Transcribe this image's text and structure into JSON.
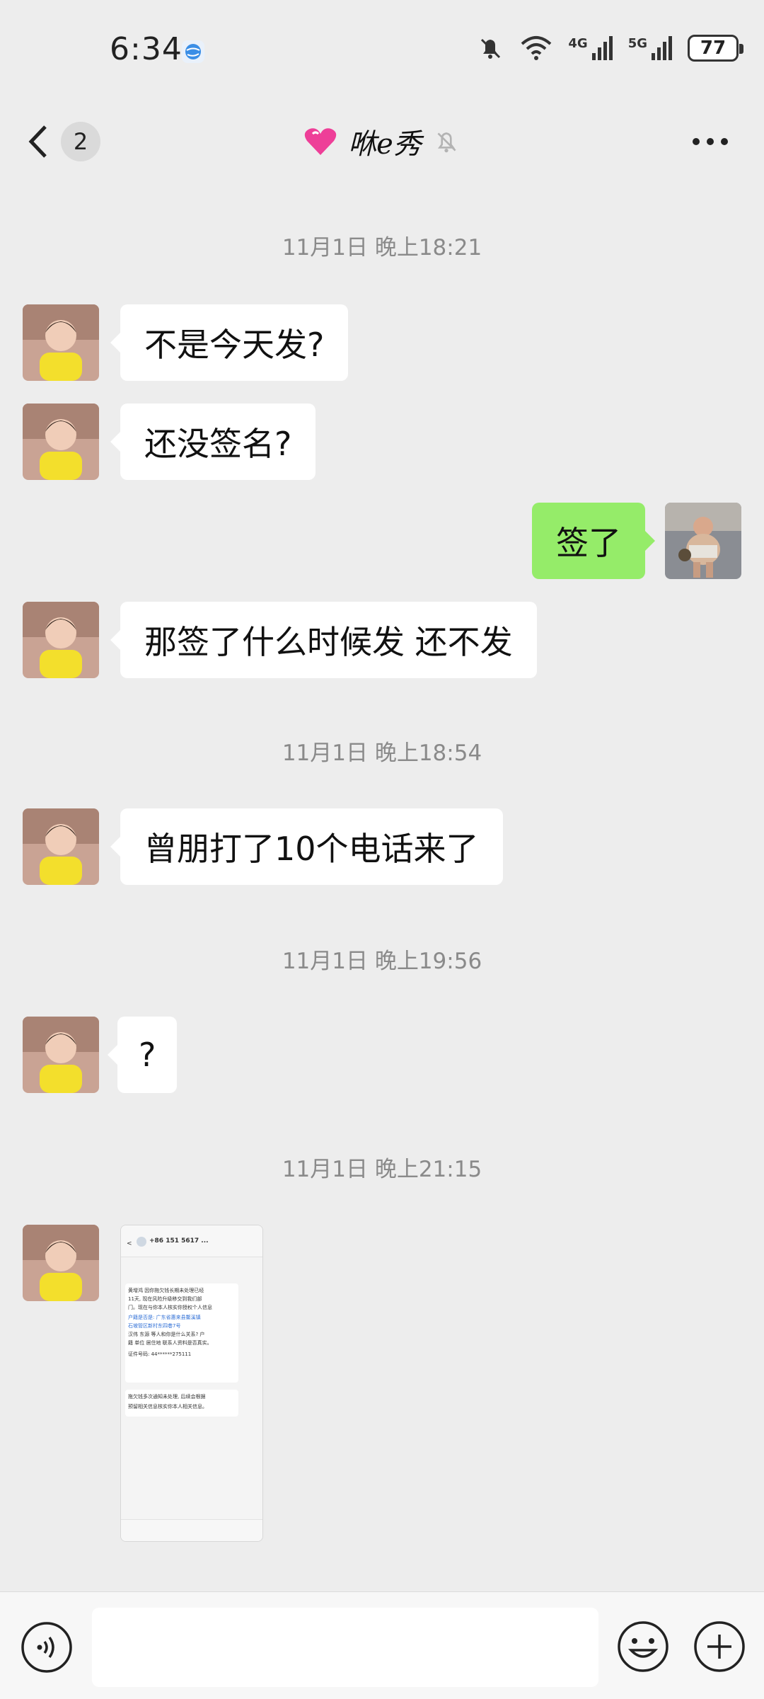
{
  "status_bar": {
    "time": "6:34",
    "network1": "4G",
    "network2": "5G",
    "battery": "77"
  },
  "header": {
    "back_badge": "2",
    "title": "咻e秀"
  },
  "messages": [
    {
      "type": "time",
      "text": "11月1日 晚上18:21"
    },
    {
      "type": "in",
      "text": "不是今天发?"
    },
    {
      "type": "in",
      "text": "还没签名?"
    },
    {
      "type": "out",
      "text": "签了"
    },
    {
      "type": "in",
      "text": "那签了什么时候发 还不发"
    },
    {
      "type": "time",
      "text": "11月1日 晚上18:54"
    },
    {
      "type": "in",
      "text": "曾朋打了10个电话来了"
    },
    {
      "type": "time",
      "text": "11月1日 晚上19:56"
    },
    {
      "type": "in",
      "text": "?"
    },
    {
      "type": "time",
      "text": "11月1日 晚上21:15"
    }
  ],
  "image_message": {
    "phone": "+86 151 5617 ...",
    "sms_line1": "黄增鸿 因你拖欠钱长期未处理已经",
    "sms_line2": "11天, 现在风险升级移交到我们部",
    "sms_line3": "门。现在与你本人核实你授权个人信息",
    "sms_line4": "户籍是否是: 广东省惠来县鳌溪镇",
    "sms_line5": "石坡管区新村东四巷7号",
    "sms_line6": "汉伟 东源 等人和你是什么关系? 户",
    "sms_line7": "籍 单位 居住地 联系人资料是否真实。",
    "sms_line8": "证件号码: 44******275111",
    "sms_line9": "拖欠钱多次通知未处理, 后续会根据",
    "sms_line10": "预留相关信息核实你本人相关信息。"
  }
}
